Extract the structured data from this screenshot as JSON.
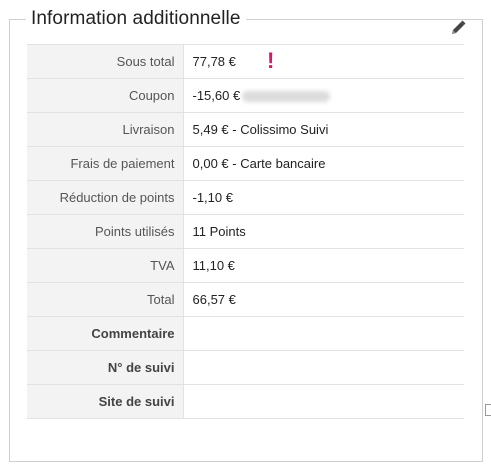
{
  "panel": {
    "title": "Information additionnelle",
    "edit_icon": "pencil-icon"
  },
  "rows": [
    {
      "label": "Sous total",
      "value": "77,78 €"
    },
    {
      "label": "Coupon",
      "value": "-15,60 €"
    },
    {
      "label": "Livraison",
      "value": "5,49 € - Colissimo Suivi"
    },
    {
      "label": "Frais de paiement",
      "value": "0,00 € - Carte bancaire"
    },
    {
      "label": "Réduction de points",
      "value": "-1,10 €"
    },
    {
      "label": "Points utilisés",
      "value": "11 Points"
    },
    {
      "label": "TVA",
      "value": "11,10 €"
    },
    {
      "label": "Total",
      "value": "66,57 €"
    },
    {
      "label": "Commentaire",
      "value": ""
    },
    {
      "label": "N° de suivi",
      "value": ""
    },
    {
      "label": "Site de suivi",
      "value": ""
    }
  ],
  "alert_mark": "!",
  "colors": {
    "alert": "#e0106f",
    "label_bg": "#f3f3f3",
    "border": "#e2e2e2"
  }
}
